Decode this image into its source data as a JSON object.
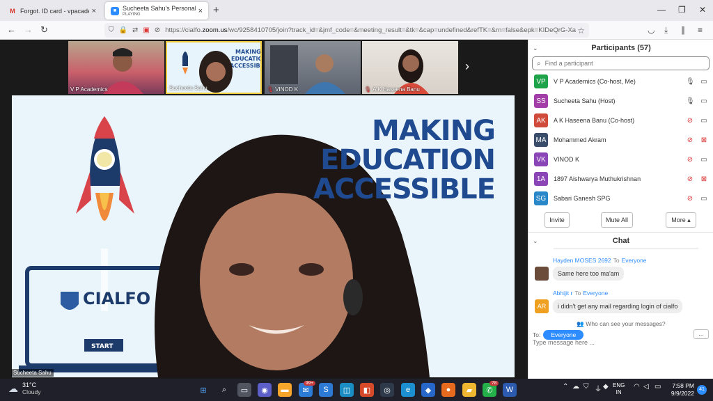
{
  "browser": {
    "tabs": [
      {
        "title": "Forgot. ID card - vpacademics@",
        "icon": "gmail-icon"
      },
      {
        "title": "Sucheeta Sahu's Personal Meeti",
        "subtitle": "PLAYING",
        "icon": "zoom-icon"
      }
    ],
    "url_prefix": "https://cialfo.",
    "url_host": "zoom.us",
    "url_rest": "/wc/9258410705/join?track_id=&jmf_code=&meeting_result=&tk=&cap=undefined&refTK=&rn=false&epk=KIDeQrG-Xa"
  },
  "meeting": {
    "thumbnails": [
      {
        "name": "V P Academics",
        "muted": false,
        "selected": false
      },
      {
        "name": "Sucheeta Sahu",
        "muted": false,
        "selected": true
      },
      {
        "name": "VINOD K",
        "muted": true,
        "selected": false
      },
      {
        "name": "A K Haseena Banu",
        "muted": true,
        "selected": false
      }
    ],
    "main_speaker": "Sucheeta Sahu",
    "slide": {
      "line1": "MAKING",
      "line2": "EDUCATION",
      "line3": "ACCESSIBLE",
      "logo_text": "CIALFO",
      "rocket_label": "START"
    }
  },
  "participants": {
    "title": "Participants (57)",
    "search_placeholder": "Find a participant",
    "list": [
      {
        "initials": "VP",
        "name": "V P Academics (Co-host, Me)",
        "color": "#1fa34a",
        "muted": false,
        "video_off": false
      },
      {
        "initials": "SS",
        "name": "Sucheeta Sahu (Host)",
        "color": "#a33ea8",
        "muted": false,
        "video_off": false
      },
      {
        "initials": "AK",
        "name": "A K Haseena Banu (Co-host)",
        "color": "#d14b3a",
        "muted": true,
        "video_off": false
      },
      {
        "initials": "MA",
        "name": "Mohammed Akram",
        "color": "#3a4d6b",
        "muted": true,
        "video_off": true
      },
      {
        "initials": "VK",
        "name": "VINOD K",
        "color": "#8a45b7",
        "muted": true,
        "video_off": false
      },
      {
        "initials": "1A",
        "name": "1897 Aishwarya Muthukrishnan",
        "color": "#8a45b7",
        "muted": true,
        "video_off": true
      },
      {
        "initials": "SG",
        "name": "Sabari Ganesh SPG",
        "color": "#2a88c8",
        "muted": true,
        "video_off": false
      }
    ],
    "buttons": {
      "invite": "Invite",
      "mute_all": "Mute All",
      "more": "More ▴"
    }
  },
  "chat": {
    "title": "Chat",
    "messages": [
      {
        "sender": "Hayden MOSES 2692",
        "to_word": "To",
        "recipient": "Everyone",
        "text": "Same here too ma'am",
        "initials": "",
        "color": "#6b4b3a"
      },
      {
        "sender": "Abhijit r",
        "to_word": "To",
        "recipient": "Everyone",
        "text": "i didn't get any mail regarding login of cialfo",
        "initials": "AR",
        "color": "#f0a020"
      }
    ],
    "who_can_see": "Who can see your messages?",
    "to_label": "To:",
    "recipient": "Everyone",
    "input_placeholder": "Type message here ...",
    "more": "..."
  },
  "taskbar": {
    "temp": "31°C",
    "condition": "Cloudy",
    "lang_top": "ENG",
    "lang_bottom": "IN",
    "time": "7:58 PM",
    "date": "9/9/2022",
    "mail_badge": "99+",
    "whatsapp_badge": "78",
    "notifications": "41"
  }
}
